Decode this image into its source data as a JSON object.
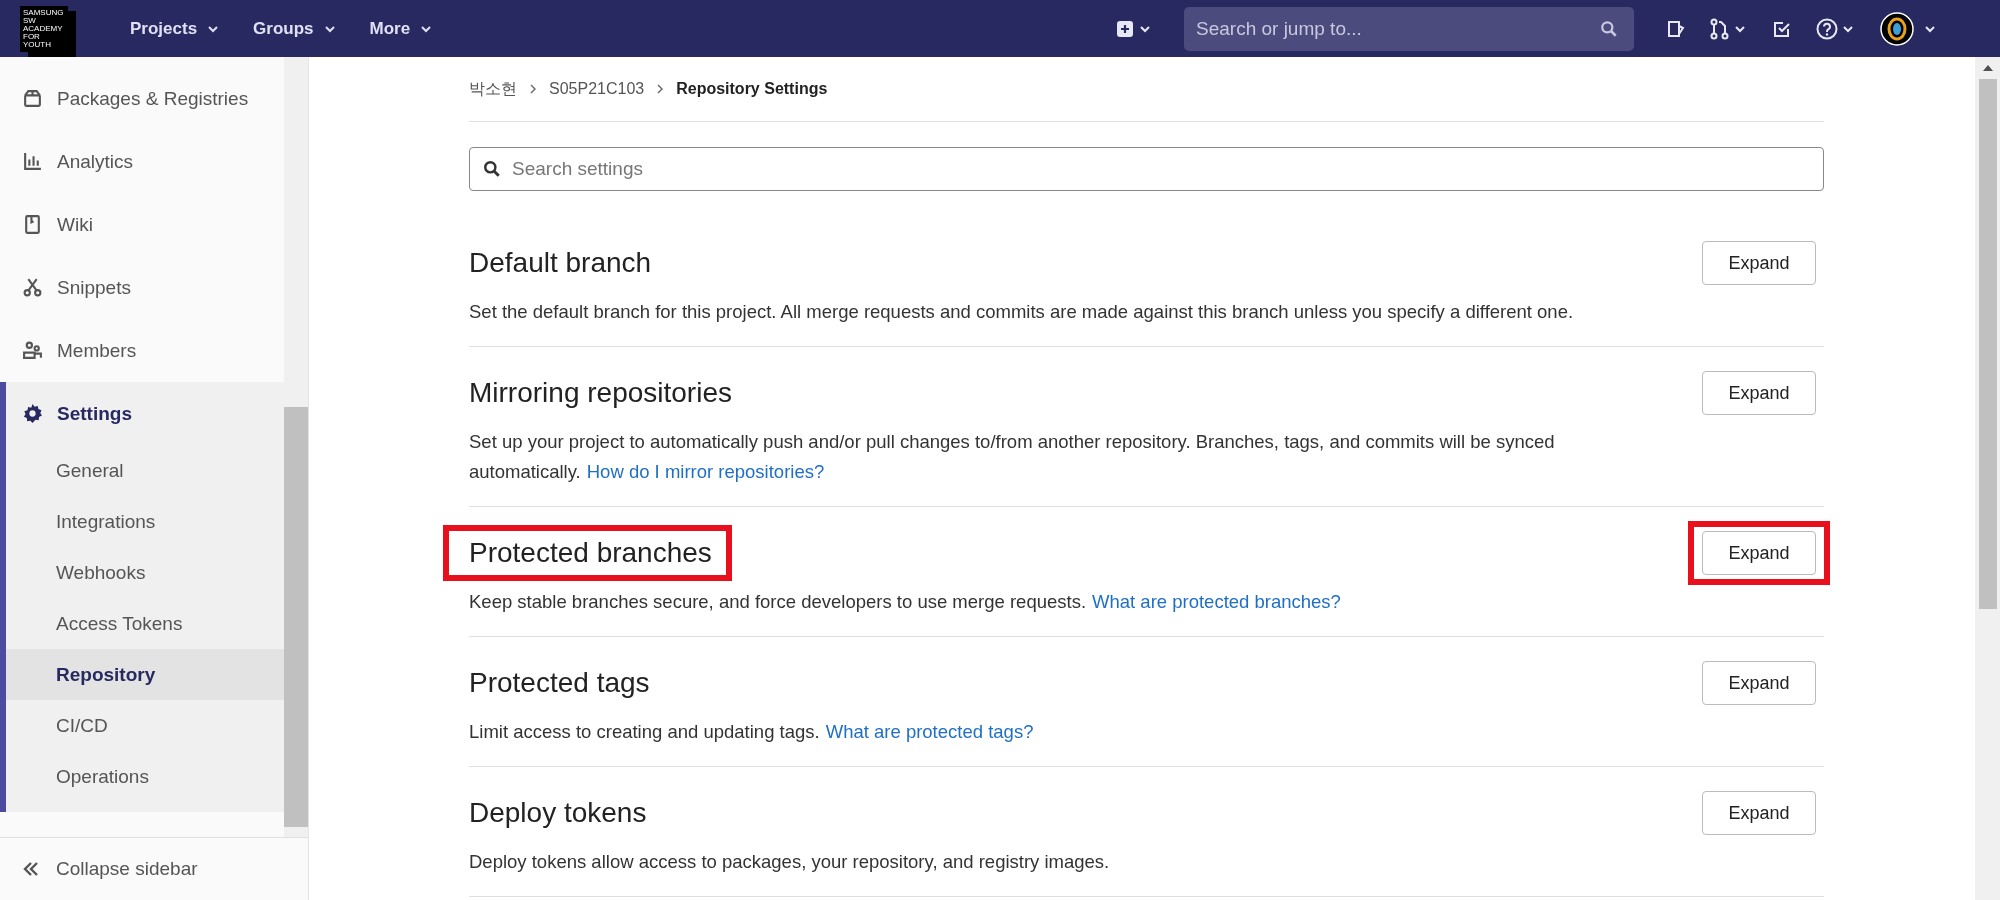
{
  "top_bar": {
    "logo_text": "SAMSUNG SW ACADEMY FOR YOUTH",
    "nav": [
      {
        "label": "Projects"
      },
      {
        "label": "Groups"
      },
      {
        "label": "More"
      }
    ],
    "search": {
      "placeholder": "Search or jump to..."
    }
  },
  "sidebar": {
    "items": [
      {
        "label": "Packages & Registries",
        "selected": false
      },
      {
        "label": "Analytics",
        "selected": false
      },
      {
        "label": "Wiki",
        "selected": false
      },
      {
        "label": "Snippets",
        "selected": false
      },
      {
        "label": "Members",
        "selected": false
      },
      {
        "label": "Settings",
        "selected": true,
        "expanded": true,
        "children": [
          {
            "label": "General",
            "selected": false
          },
          {
            "label": "Integrations",
            "selected": false
          },
          {
            "label": "Webhooks",
            "selected": false
          },
          {
            "label": "Access Tokens",
            "selected": false
          },
          {
            "label": "Repository",
            "selected": true
          },
          {
            "label": "CI/CD",
            "selected": false
          },
          {
            "label": "Operations",
            "selected": false
          }
        ]
      }
    ],
    "collapse_label": "Collapse sidebar"
  },
  "breadcrumb": [
    {
      "label": "박소현"
    },
    {
      "label": "S05P21C103"
    },
    {
      "label": "Repository Settings"
    }
  ],
  "search": {
    "placeholder": "Search settings"
  },
  "sections": [
    {
      "title": "Default branch",
      "description": "Set the default branch for this project. All merge requests and commits are made against this branch unless you specify a different one.",
      "button": "Expand",
      "highlighted": false
    },
    {
      "title": "Mirroring repositories",
      "description": "Set up your project to automatically push and/or pull changes to/from another repository. Branches, tags, and commits will be synced automatically.",
      "link": "How do I mirror repositories?",
      "button": "Expand",
      "highlighted": false
    },
    {
      "title": "Protected branches",
      "description": "Keep stable branches secure, and force developers to use merge requests.",
      "link": "What are protected branches?",
      "button": "Expand",
      "highlighted": true
    },
    {
      "title": "Protected tags",
      "description": "Limit access to creating and updating tags.",
      "link": "What are protected tags?",
      "button": "Expand",
      "highlighted": false
    },
    {
      "title": "Deploy tokens",
      "description": "Deploy tokens allow access to packages, your repository, and registry images.",
      "button": "Expand",
      "highlighted": false
    }
  ]
}
